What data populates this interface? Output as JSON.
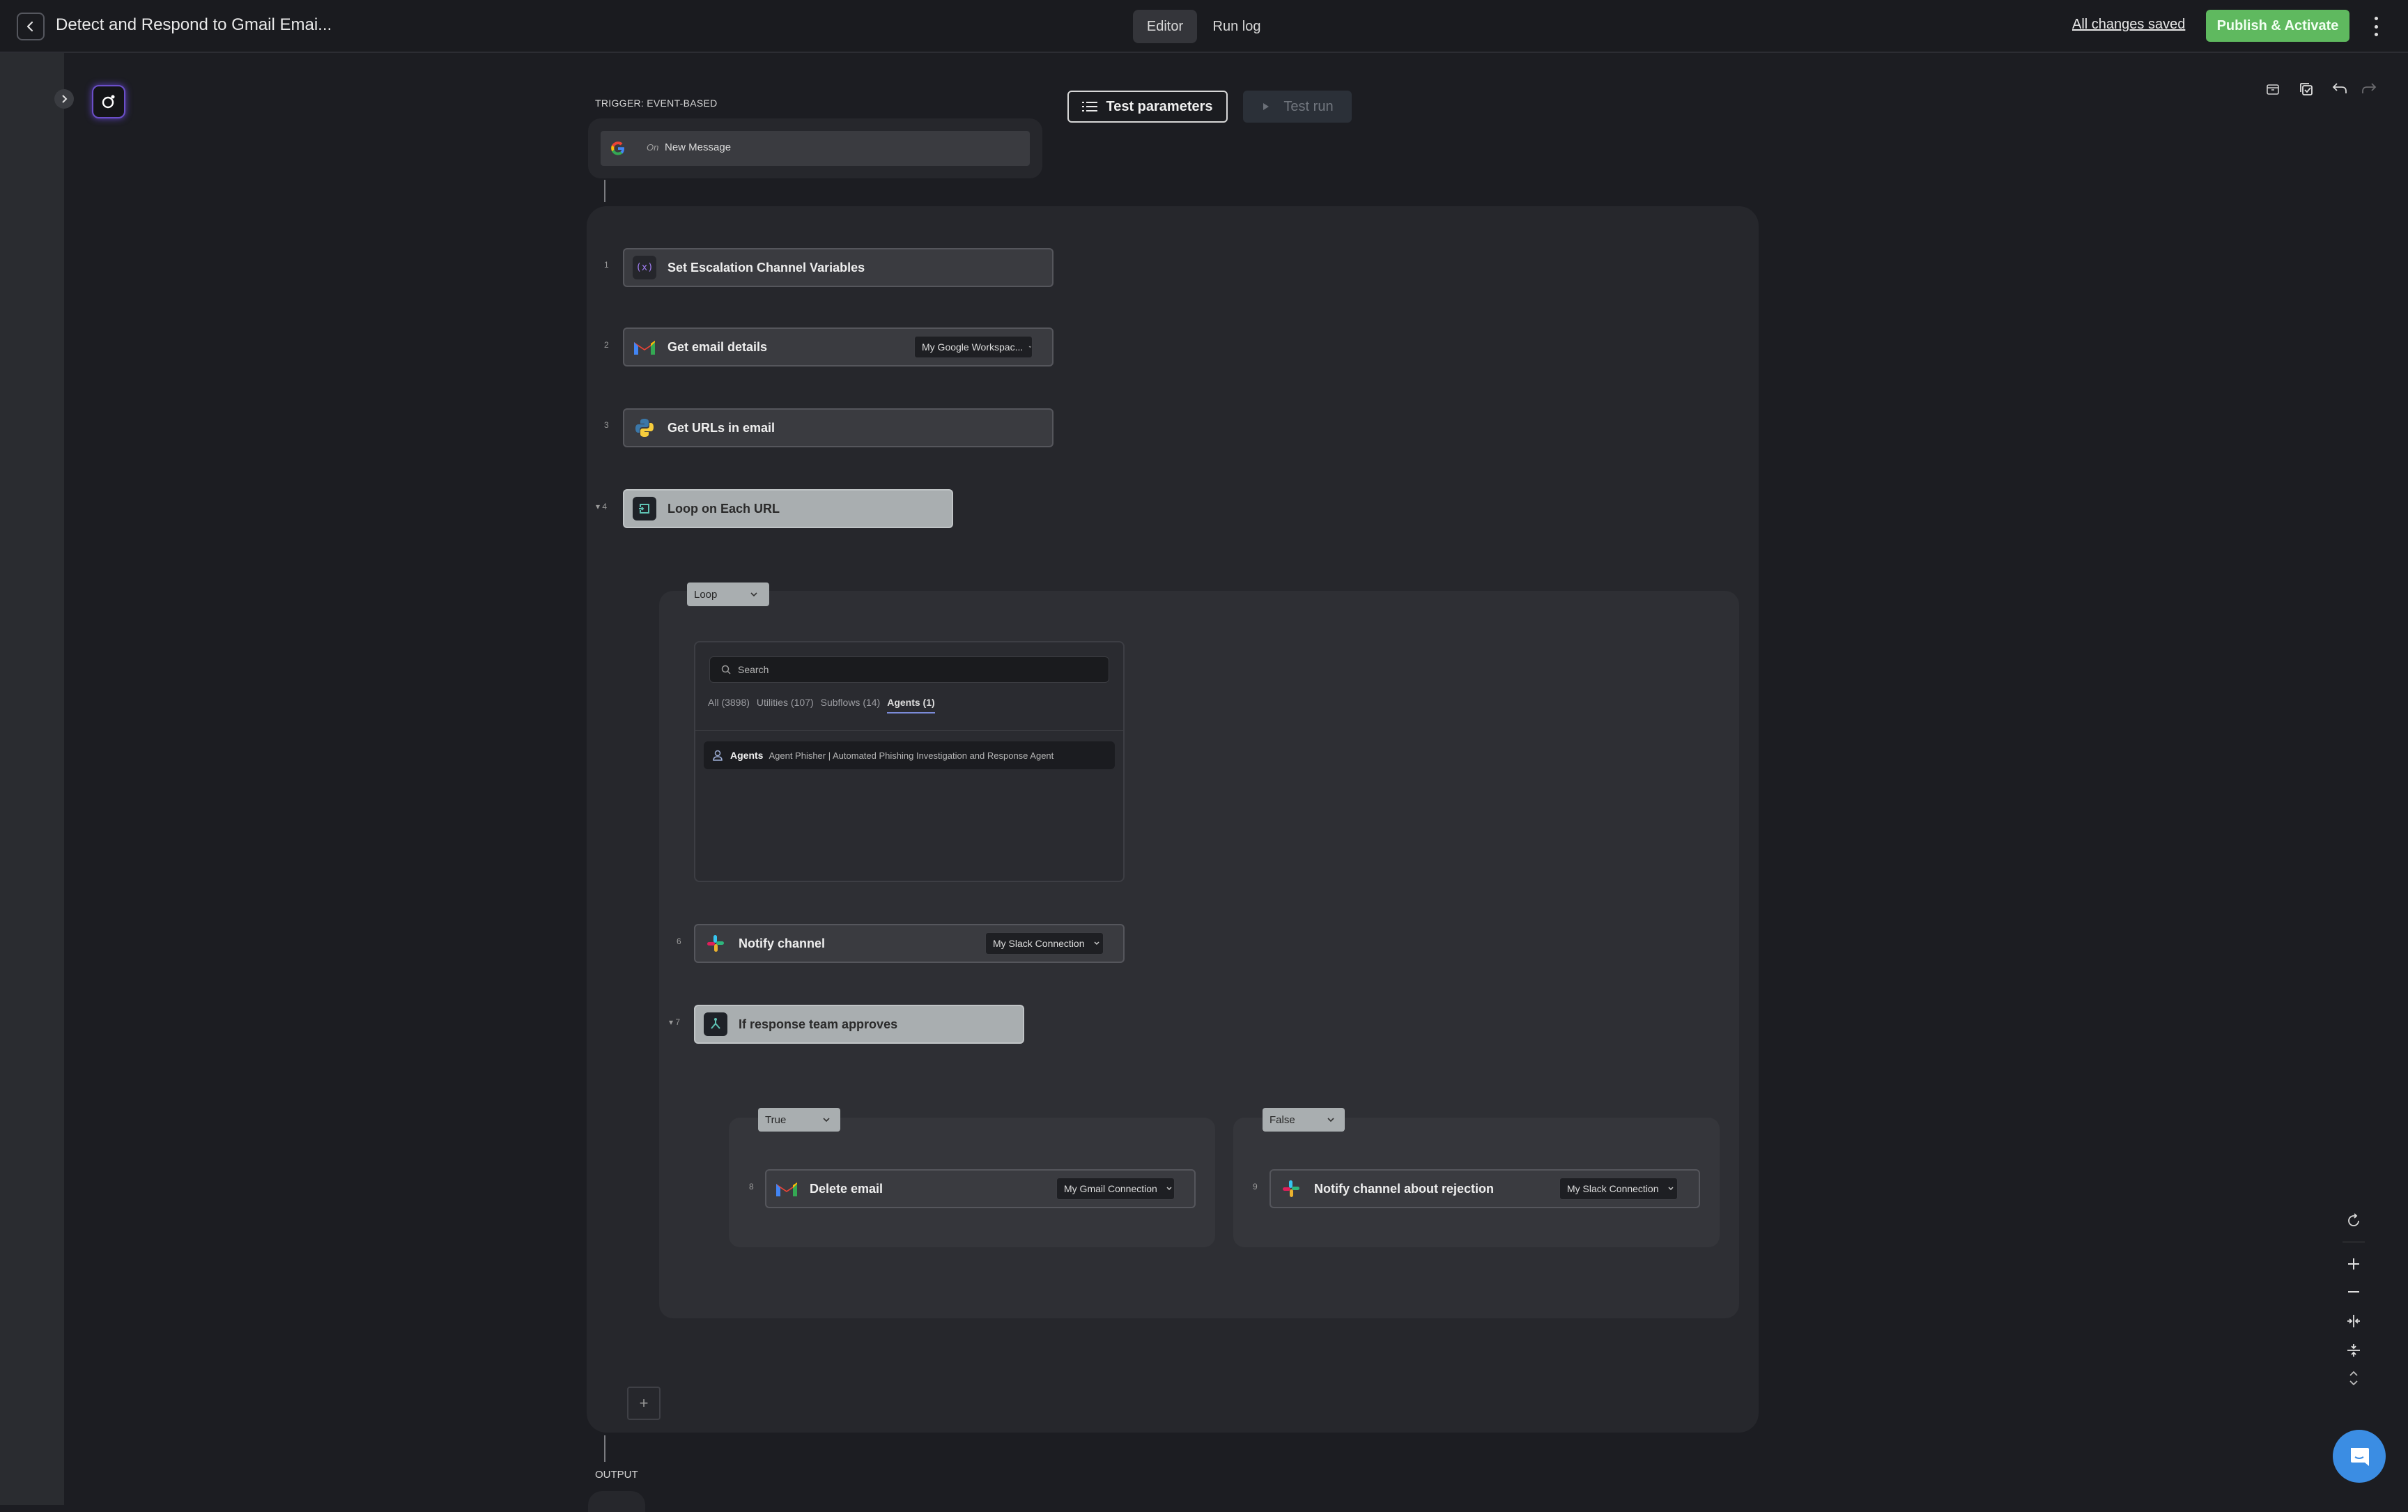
{
  "header": {
    "title": "Detect and Respond to Gmail Emai...",
    "tabs": [
      {
        "label": "Editor",
        "active": true
      },
      {
        "label": "Run log",
        "active": false
      }
    ],
    "saved_status": "All changes saved",
    "publish_label": "Publish & Activate"
  },
  "toolbar": {
    "test_parameters": "Test parameters",
    "test_run": "Test run"
  },
  "trigger": {
    "label": "TRIGGER: EVENT-BASED",
    "on_label": "On",
    "event": "New Message",
    "icon": "google-icon"
  },
  "steps": [
    {
      "num": "1",
      "label": "Set Escalation Channel Variables",
      "icon": "variables-icon"
    },
    {
      "num": "2",
      "label": "Get email details",
      "icon": "gmail-icon",
      "connection": "My Google Workspac..."
    },
    {
      "num": "3",
      "label": "Get URLs in email",
      "icon": "python-icon"
    },
    {
      "num": "4",
      "label": "Loop on Each URL",
      "icon": "loop-icon"
    },
    {
      "num": "6",
      "label": "Notify channel",
      "icon": "slack-icon",
      "connection": "My Slack Connection"
    },
    {
      "num": "7",
      "label": "If response team approves",
      "icon": "branch-icon"
    },
    {
      "num": "8",
      "label": "Delete email",
      "icon": "gmail-icon",
      "connection": "My Gmail Connection"
    },
    {
      "num": "9",
      "label": "Notify channel about rejection",
      "icon": "slack-icon",
      "connection": "My Slack Connection"
    }
  ],
  "loop_pill": "Loop",
  "branches": {
    "true_label": "True",
    "false_label": "False"
  },
  "action_picker": {
    "search_placeholder": "Search",
    "tabs": [
      {
        "label": "All (3898)",
        "active": false
      },
      {
        "label": "Utilities (107)",
        "active": false
      },
      {
        "label": "Subflows (14)",
        "active": false
      },
      {
        "label": "Agents (1)",
        "active": true
      }
    ],
    "result": {
      "category": "Agents",
      "text": "Agent Phisher | Automated Phishing Investigation and Response Agent"
    }
  },
  "output_label": "OUTPUT",
  "add_step": "+",
  "colors": {
    "accent": "#5fb95f",
    "background": "#1c1d22",
    "chat": "#3b8de3"
  }
}
